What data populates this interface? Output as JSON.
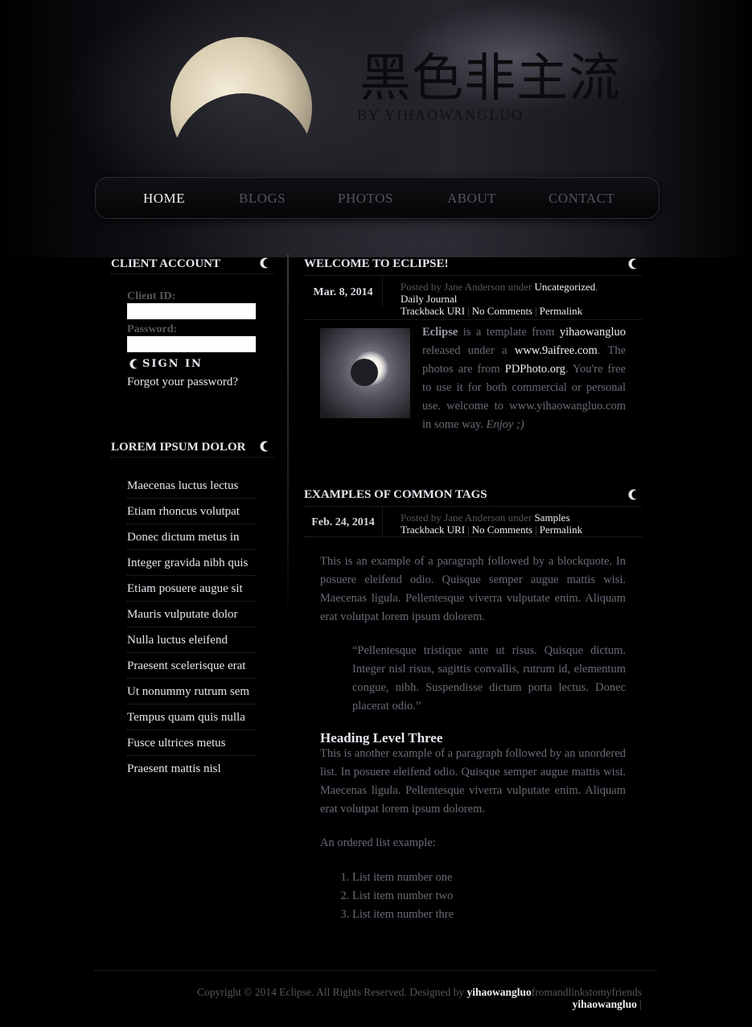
{
  "site": {
    "title": "黑色非主流",
    "subtitle": "BY YIHAOWANGLUO"
  },
  "nav": [
    "HOME",
    "BLOGS",
    "PHOTOS",
    "ABOUT",
    "CONTACT"
  ],
  "sidebar": {
    "account": {
      "heading": "CLIENT ACCOUNT",
      "client_id_label": "Client ID:",
      "password_label": "Password:",
      "signin_label": "SIGN IN",
      "forgot_label": "Forgot your password?"
    },
    "links": {
      "heading": "LOREM IPSUM DOLOR",
      "items": [
        "Maecenas luctus lectus",
        "Etiam rhoncus volutpat",
        "Donec dictum metus in",
        "Integer gravida nibh quis",
        "Etiam posuere augue sit",
        "Mauris vulputate dolor",
        "Nulla luctus eleifend",
        "Praesent scelerisque erat",
        "Ut nonummy rutrum sem",
        "Tempus quam quis nulla",
        "Fusce ultrices metus",
        "Praesent mattis nisl"
      ]
    }
  },
  "posts": [
    {
      "title": "WELCOME TO ECLIPSE!",
      "date": "Mar. 8, 2014",
      "meta_prefix": "Posted by Jane Anderson under",
      "cat1": "Uncategorized",
      "cat2": "Daily Journal",
      "trackback": "Trackback URI",
      "comments": "No Comments",
      "permalink": "Permalink",
      "body": {
        "eclipse": "Eclipse",
        "t1": " is a template from ",
        "link1": "yihaowangluo",
        "t2": " released under a ",
        "link2": "www.9aifree.com",
        "t3": ". The photos are from ",
        "link3": "PDPhoto.org",
        "t4": ". You're free to use it for both commercial or personal use. welcome to www.yihaowangluo.com in some way. ",
        "enjoy": "Enjoy ;)"
      }
    },
    {
      "title": "EXAMPLES OF COMMON TAGS",
      "date": "Feb. 24, 2014",
      "meta_prefix": "Posted by Jane Anderson under",
      "cat1": "Samples",
      "trackback": "Trackback URI",
      "comments": "No Comments",
      "permalink": "Permalink",
      "p1": "This is an example of a paragraph followed by a blockquote. In posuere eleifend odio. Quisque semper augue mattis wisi. Maecenas ligula. Pellentesque viverra vulputate enim. Aliquam erat volutpat lorem ipsum dolorem.",
      "quote": "“Pellentesque tristique ante ut risus. Quisque dictum. Integer nisl risus, sagittis convallis, rutrum id, elementum congue, nibh. Suspendisse dictum porta lectus. Donec placerat odio.”",
      "h3": "Heading Level Three",
      "p2": "This is another example of a paragraph followed by an unordered list. In posuere eleifend odio. Quisque semper augue mattis wisi. Maecenas ligula. Pellentesque viverra vulputate enim. Aliquam erat volutpat lorem ipsum dolorem.",
      "ol_intro": "An ordered list example:",
      "ol": [
        "List item number one",
        "List item number two",
        "List item number thre"
      ]
    }
  ],
  "footer": {
    "copyright": "Copyright © 2014 Eclipse. All Rights Reserved. Designed by ",
    "designer": "yihaowangluo",
    "friends": "fromandlinkstomyfriends",
    "designer2": "yihaowangluo",
    "pipe": " | "
  }
}
